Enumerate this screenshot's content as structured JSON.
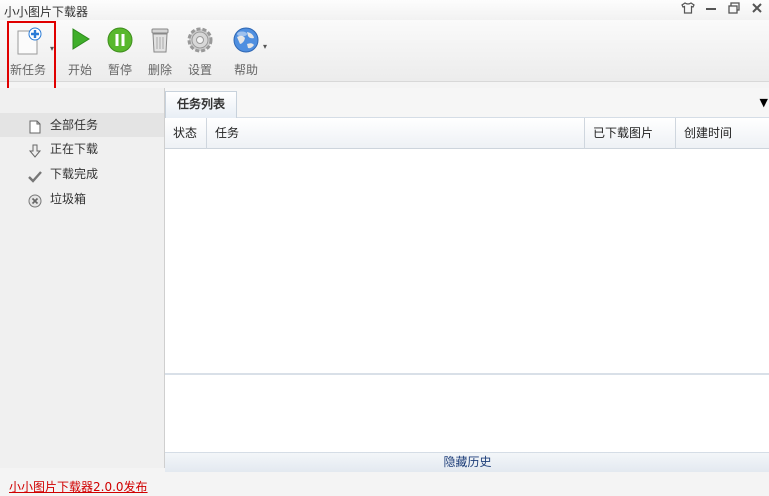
{
  "window": {
    "title": "小小图片下载器",
    "controls": [
      "shirt-icon",
      "minimize-icon",
      "restore-icon",
      "close-icon"
    ]
  },
  "toolbar": {
    "new_task": "新任务",
    "start": "开始",
    "pause": "暂停",
    "delete": "删除",
    "settings": "设置",
    "help": "帮助"
  },
  "sidebar": {
    "items": [
      {
        "label": "全部任务",
        "icon": "document-icon",
        "active": true
      },
      {
        "label": "正在下载",
        "icon": "download-arrow-icon",
        "active": false
      },
      {
        "label": "下载完成",
        "icon": "checkmark-icon",
        "active": false
      },
      {
        "label": "垃圾箱",
        "icon": "trash-icon",
        "active": false
      }
    ]
  },
  "main": {
    "tab_label": "任务列表",
    "columns": [
      "状态",
      "任务",
      "已下载图片",
      "创建时间"
    ],
    "rows": [],
    "history_label": "隐藏历史"
  },
  "status": {
    "link_text": "小小图片下载器2.0.0发布"
  },
  "colors": {
    "highlight": "#e00000",
    "status_link": "#d00000",
    "start_green": "#3fae2a",
    "pause_green": "#58b82c"
  }
}
